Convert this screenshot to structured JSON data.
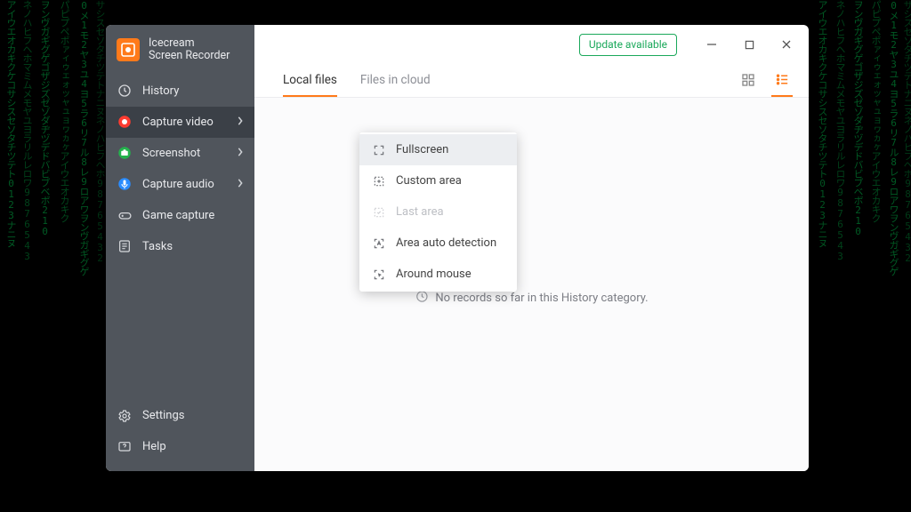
{
  "brand": {
    "name": "Icecream",
    "subtitle": "Screen Recorder"
  },
  "sidebar": {
    "items": [
      {
        "label": "History"
      },
      {
        "label": "Capture video"
      },
      {
        "label": "Screenshot"
      },
      {
        "label": "Capture audio"
      },
      {
        "label": "Game capture"
      },
      {
        "label": "Tasks"
      }
    ],
    "bottom": [
      {
        "label": "Settings"
      },
      {
        "label": "Help"
      }
    ]
  },
  "titlebar": {
    "update_label": "Update available"
  },
  "tabs": {
    "local": "Local files",
    "cloud": "Files in cloud"
  },
  "empty": {
    "text": "No records so far in this History category."
  },
  "submenu": {
    "fullscreen": "Fullscreen",
    "custom_area": "Custom area",
    "last_area": "Last area",
    "auto_detect": "Area auto detection",
    "around_mouse": "Around mouse"
  },
  "colors": {
    "accent": "#ff7a1a",
    "green": "#1aa85a"
  }
}
